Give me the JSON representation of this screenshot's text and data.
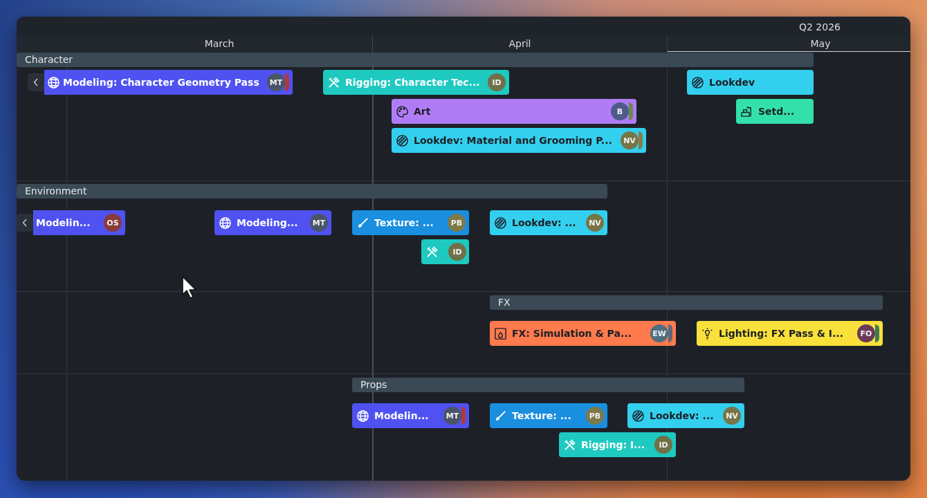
{
  "header": {
    "quarter": "Q2 2026",
    "months": [
      "March",
      "April",
      "May"
    ]
  },
  "groups": [
    {
      "name": "Character",
      "tasks": [
        {
          "kind": "modeling",
          "label": "Modeling: Character Geometry Pass",
          "color": "#4f52f0",
          "continues_left": true,
          "avatars": [
            {
              "initials": "MT",
              "color": "#4a5568"
            },
            {
              "color": "#b0383c"
            }
          ]
        },
        {
          "kind": "rigging",
          "label": "Rigging: Character Tec...",
          "color": "#1ec9c0",
          "continues_left": false,
          "avatars": [
            {
              "initials": "ID",
              "color": "#6f7048"
            }
          ]
        },
        {
          "kind": "lookdev",
          "label": "Lookdev",
          "color": "#33cfee",
          "continues_left": false
        },
        {
          "kind": "art",
          "label": "Art",
          "color": "#b07cf5",
          "continues_left": false,
          "avatars": [
            {
              "initials": "B",
              "color": "#4d5a8a"
            },
            {
              "color": "#6a8a4a"
            }
          ]
        },
        {
          "kind": "setdress",
          "label": "Setd...",
          "color": "#33e0aa",
          "continues_left": false
        },
        {
          "kind": "lookdev",
          "label": "Lookdev: Material and Grooming P...",
          "color": "#33cfee",
          "continues_left": false,
          "avatars": [
            {
              "initials": "NV",
              "color": "#777548"
            },
            {
              "color": "#8a7a48"
            }
          ]
        }
      ]
    },
    {
      "name": "Environment",
      "tasks": [
        {
          "label": "Modelin...",
          "color": "#4f52f0",
          "continues_left": true,
          "avatars": [
            {
              "initials": "OS",
              "color": "#8b3a3a"
            }
          ]
        },
        {
          "kind": "modeling",
          "label": "Modeling...",
          "color": "#4f52f0",
          "continues_left": false,
          "avatars": [
            {
              "initials": "MT",
              "color": "#4a5568"
            }
          ]
        },
        {
          "kind": "texture",
          "label": "Texture: ...",
          "color": "#1a8fe0",
          "continues_left": false,
          "avatars": [
            {
              "initials": "PB",
              "color": "#7d7a4a"
            }
          ]
        },
        {
          "kind": "lookdev",
          "label": "Lookdev: ...",
          "color": "#33cfee",
          "continues_left": false,
          "avatars": [
            {
              "initials": "NV",
              "color": "#777548"
            }
          ]
        },
        {
          "kind": "rigging",
          "color": "#1ec9c0",
          "continues_left": false,
          "avatars": [
            {
              "initials": "ID",
              "color": "#6f7048"
            }
          ]
        }
      ]
    },
    {
      "name": "FX",
      "tasks": [
        {
          "kind": "fx",
          "label": "FX: Simulation & Pa...",
          "color": "#ff7a4d",
          "continues_left": false,
          "avatars": [
            {
              "initials": "EW",
              "color": "#4f6f80"
            },
            {
              "color": "#5a6a80"
            }
          ]
        },
        {
          "kind": "lighting",
          "label": "Lighting: FX Pass & I...",
          "color": "#f9e03a",
          "continues_left": false,
          "avatars": [
            {
              "initials": "FO",
              "color": "#6b3a5a"
            },
            {
              "color": "#3a7a5a"
            }
          ]
        }
      ]
    },
    {
      "name": "Props",
      "tasks": [
        {
          "kind": "modeling",
          "label": "Modelin...",
          "color": "#4f52f0",
          "continues_left": false,
          "avatars": [
            {
              "initials": "MT",
              "color": "#4a5568"
            },
            {
              "color": "#b0383c"
            }
          ]
        },
        {
          "kind": "texture",
          "label": "Texture: ...",
          "color": "#1a8fe0",
          "continues_left": false,
          "avatars": [
            {
              "initials": "PB",
              "color": "#7d7a4a"
            }
          ]
        },
        {
          "kind": "lookdev",
          "label": "Lookdev: ...",
          "color": "#33cfee",
          "continues_left": false,
          "avatars": [
            {
              "initials": "NV",
              "color": "#777548"
            }
          ]
        },
        {
          "kind": "rigging",
          "label": "Rigging: I...",
          "color": "#1ec9c0",
          "continues_left": false,
          "avatars": [
            {
              "initials": "ID",
              "color": "#6f7048"
            }
          ]
        }
      ]
    }
  ]
}
